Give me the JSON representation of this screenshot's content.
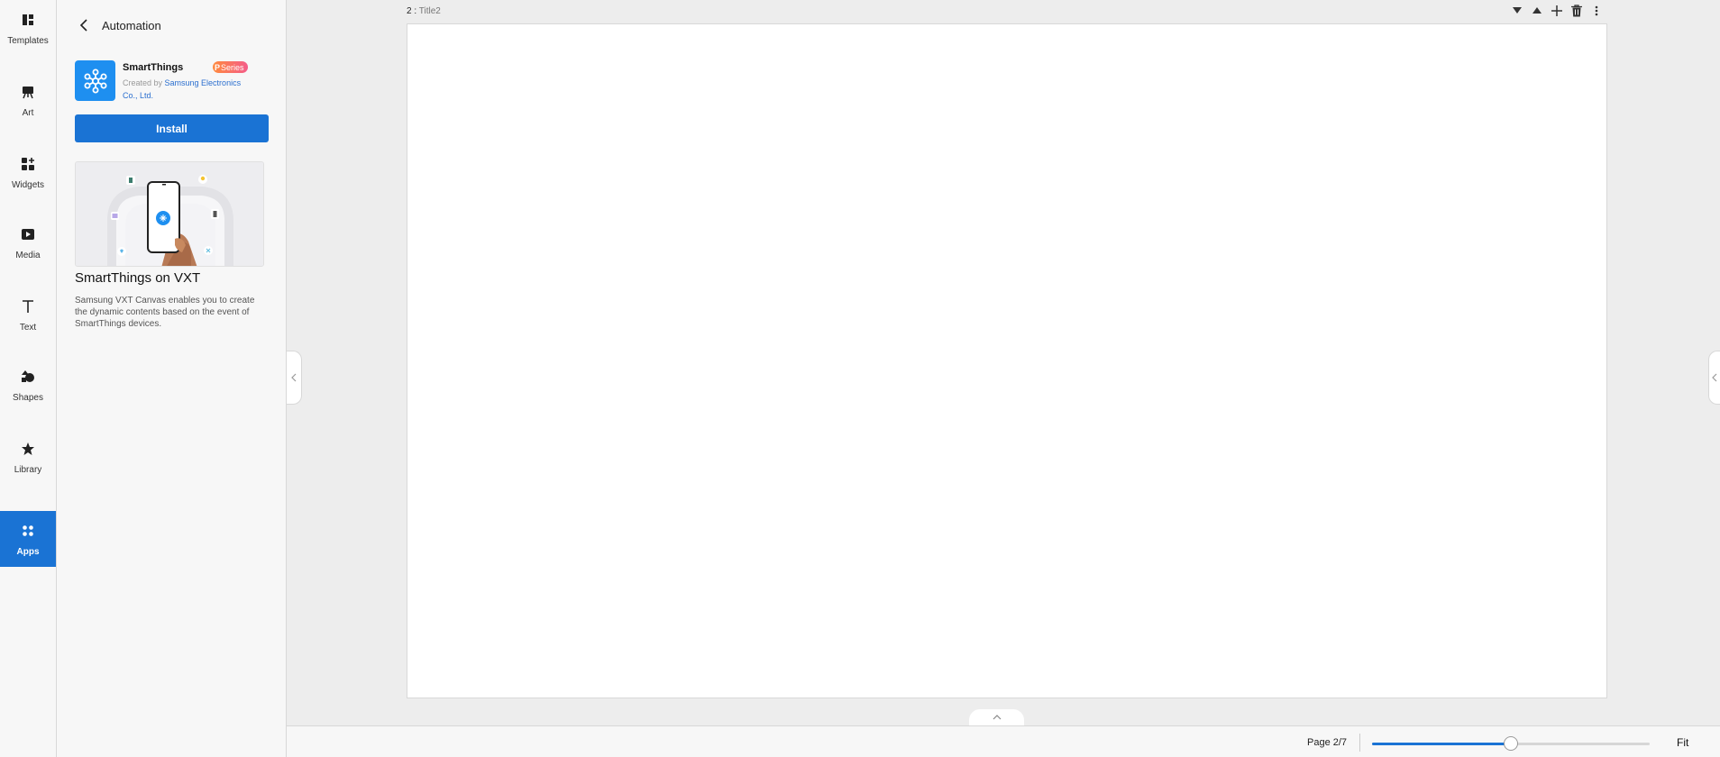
{
  "rail": {
    "items": [
      {
        "label": "Templates",
        "icon": "templates-icon"
      },
      {
        "label": "Art",
        "icon": "easel-icon"
      },
      {
        "label": "Widgets",
        "icon": "widgets-icon"
      },
      {
        "label": "Media",
        "icon": "media-icon"
      },
      {
        "label": "Text",
        "icon": "text-icon"
      },
      {
        "label": "Shapes",
        "icon": "shapes-icon"
      },
      {
        "label": "Library",
        "icon": "star-icon"
      },
      {
        "label": "Apps",
        "icon": "apps-icon",
        "active": true
      }
    ]
  },
  "panel": {
    "title": "Automation",
    "app": {
      "name": "SmartThings",
      "badge": "Series",
      "badge_prefix": "P",
      "created_prefix": "Created by ",
      "creator": "Samsung Electronics Co., Ltd.",
      "install_label": "Install"
    },
    "promo_title": "SmartThings on VXT",
    "promo_desc": "Samsung VXT Canvas enables you to create the dynamic contents based on the event of SmartThings devices."
  },
  "canvas": {
    "page_number": "2 :",
    "page_title": "Title2"
  },
  "bottom": {
    "page_indicator": "Page 2/7",
    "zoom_level": 0.5,
    "fit_label": "Fit"
  },
  "colors": {
    "accent": "#1a73d4",
    "app_icon_bg": "#1e8ff0"
  }
}
